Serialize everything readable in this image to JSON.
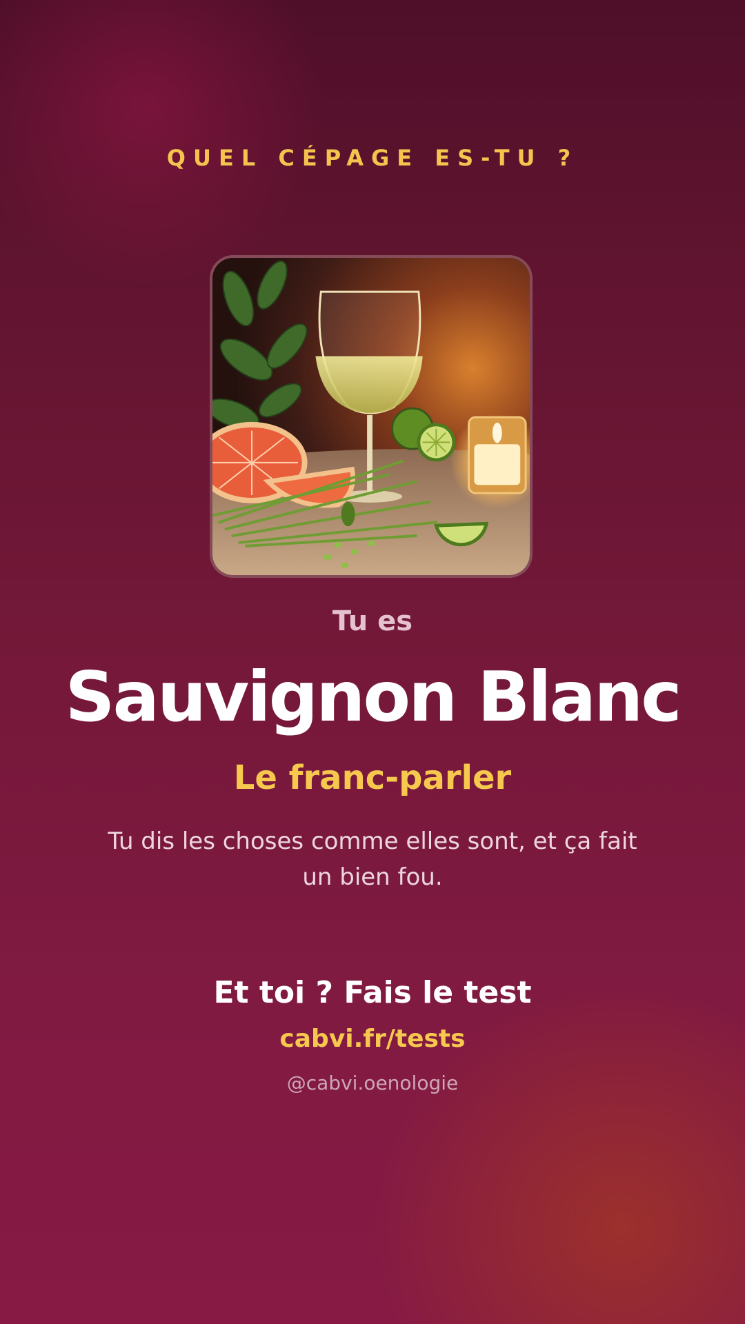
{
  "header": {
    "kicker": "QUEL CÉPAGE ES-TU ?"
  },
  "result": {
    "image_alt": "wine-glass-with-grapefruit-lime-chives-candle",
    "intro": "Tu es",
    "grape_name": "Sauvignon Blanc",
    "tagline": "Le franc-parler",
    "description": "Tu dis les choses comme elles sont, et ça fait un bien fou."
  },
  "footer": {
    "cta": "Et toi ? Fais le test",
    "link": "cabvi.fr/tests",
    "handle": "@cabvi.oenologie"
  },
  "colors": {
    "background_top": "#4f0f29",
    "background_bottom": "#861a44",
    "accent_gold": "#f7c84e",
    "text_white": "#ffffff"
  }
}
